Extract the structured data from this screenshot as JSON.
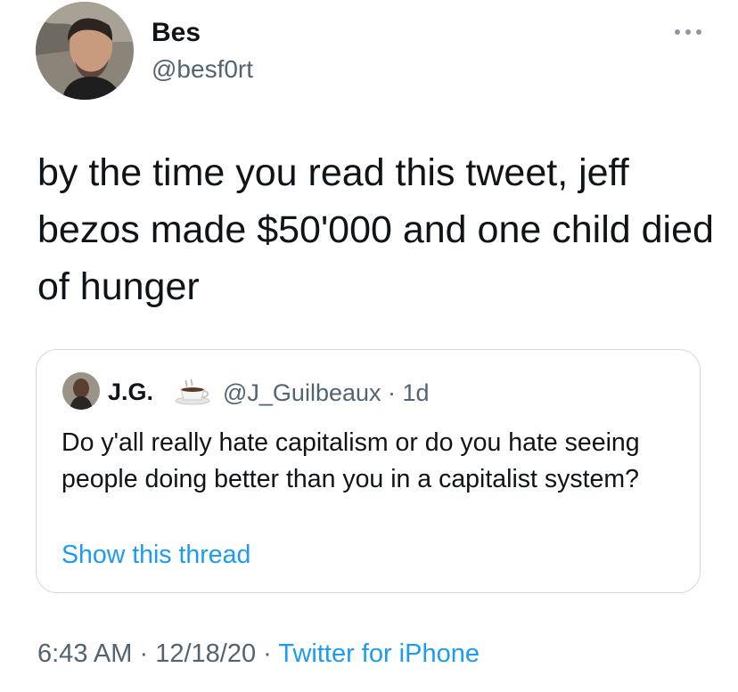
{
  "author": {
    "display_name": "Bes",
    "handle": "@besf0rt",
    "avatar_icon": "profile-photo"
  },
  "more_icon": "more-dots-icon",
  "tweet": {
    "text": "by the time you read this tweet, jeff bezos made $50'000 and one child died of hunger"
  },
  "quote": {
    "display_name": "J.G.",
    "emoji_icon": "coffee-cup-icon",
    "handle_time": "@J_Guilbeaux · 1d",
    "text": "Do y'all really hate capitalism or do you hate seeing people doing better than you in a capitalist system?",
    "show_thread": "Show this thread"
  },
  "meta": {
    "time": "6:43 AM",
    "separator": " · ",
    "date": "12/18/20",
    "source": "Twitter for iPhone"
  },
  "colors": {
    "link": "#1d9bf0",
    "secondary": "#536471",
    "primary": "#0f1419",
    "border": "#cfd9de"
  }
}
